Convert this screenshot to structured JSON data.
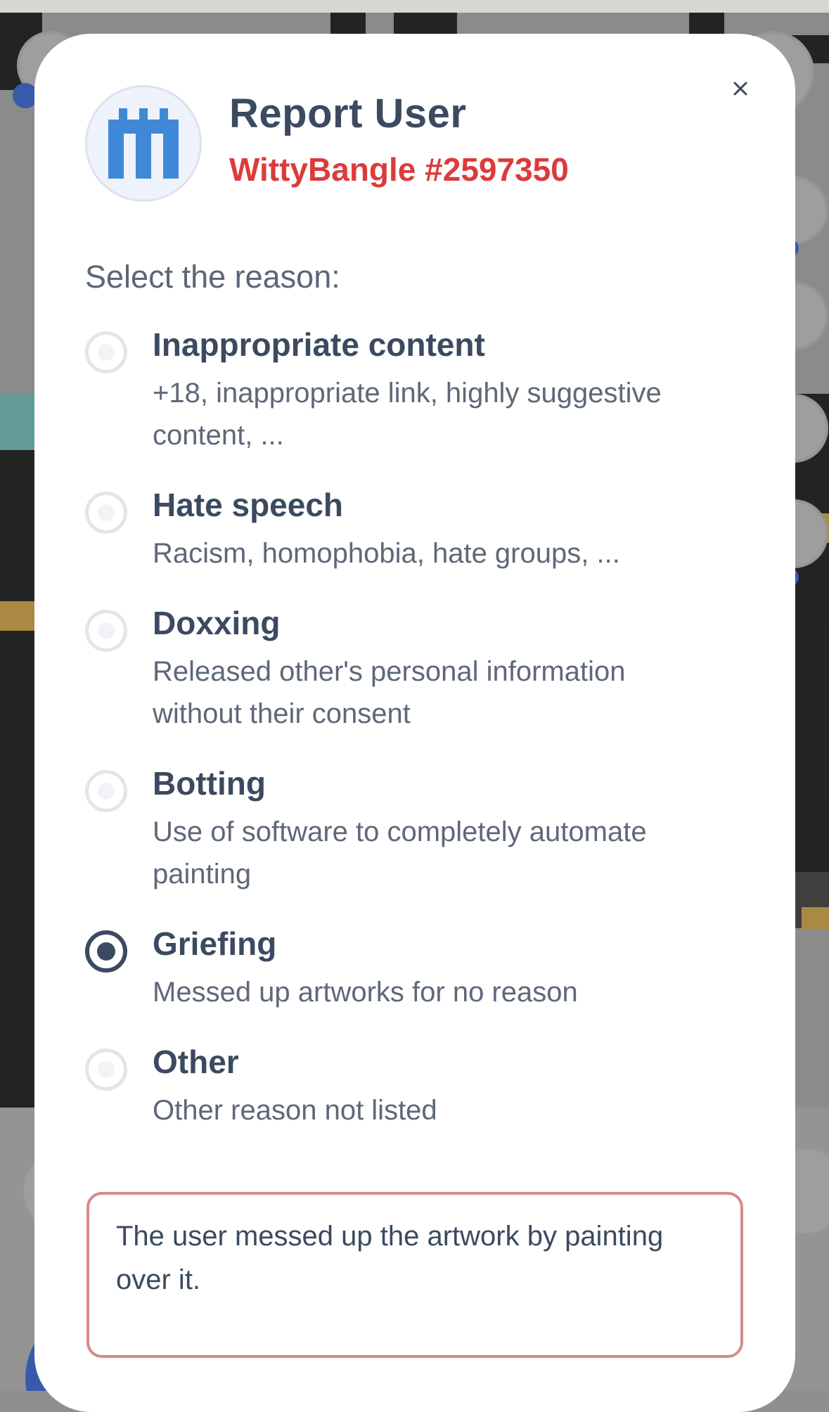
{
  "modal": {
    "title": "Report User",
    "subtitle": "WittyBangle #2597350",
    "prompt": "Select the reason:",
    "close_icon": "close-icon",
    "avatar_icon": "pixel-logo-icon",
    "accent_color": "#dd3b3b",
    "text_color": "#3b4a60",
    "options": [
      {
        "label": "Inappropriate content",
        "description": "+18, inappropriate link, highly suggestive content, ...",
        "checked": false
      },
      {
        "label": "Hate speech",
        "description": "Racism, homophobia, hate groups, ...",
        "checked": false
      },
      {
        "label": "Doxxing",
        "description": "Released other's personal information without their consent",
        "checked": false
      },
      {
        "label": "Botting",
        "description": "Use of software to completely automate painting",
        "checked": false
      },
      {
        "label": "Griefing",
        "description": "Messed up artworks for no reason",
        "checked": true
      },
      {
        "label": "Other",
        "description": "Other reason not listed",
        "checked": false
      }
    ],
    "comment": "The user messed up the artwork by painting over it."
  }
}
